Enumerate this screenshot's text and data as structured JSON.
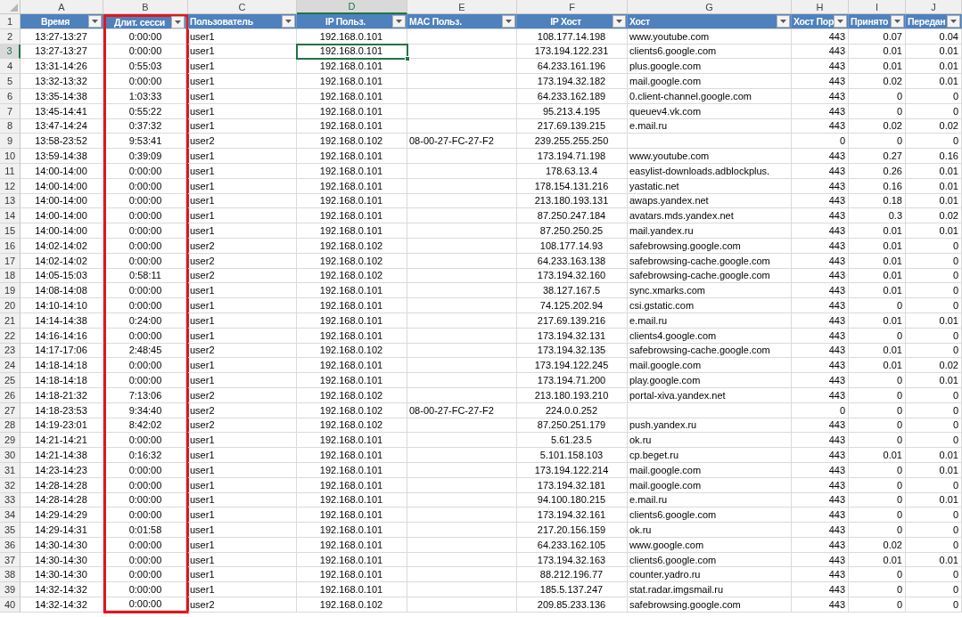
{
  "sheet": {
    "columns": [
      {
        "letter": "A",
        "title": "Время",
        "selected": false,
        "highlighted": false
      },
      {
        "letter": "B",
        "title": "Длит. сесси",
        "selected": false,
        "highlighted": true
      },
      {
        "letter": "C",
        "title": "Пользователь",
        "selected": false,
        "highlighted": false
      },
      {
        "letter": "D",
        "title": "IP Польз.",
        "selected": true,
        "highlighted": false
      },
      {
        "letter": "E",
        "title": "MAC Польз.",
        "selected": false,
        "highlighted": false
      },
      {
        "letter": "F",
        "title": "IP Хост",
        "selected": false,
        "highlighted": false
      },
      {
        "letter": "G",
        "title": "Хост",
        "selected": false,
        "highlighted": false
      },
      {
        "letter": "H",
        "title": "Хост Пор",
        "selected": false,
        "highlighted": false
      },
      {
        "letter": "I",
        "title": "Принято",
        "selected": false,
        "highlighted": false
      },
      {
        "letter": "J",
        "title": "Передан",
        "selected": false,
        "highlighted": false
      }
    ],
    "header_row": {
      "number": "1",
      "selected": false
    },
    "rows": [
      {
        "number": "2",
        "selected": false,
        "time": "13:27-13:27",
        "session_duration": "0:00:00",
        "user": "user1",
        "user_ip": "192.168.0.101",
        "host_ip": "108.177.14.198",
        "host": "www.youtube.com",
        "host_port": "443",
        "received": "0.07",
        "sent": "0.04"
      },
      {
        "number": "3",
        "selected": true,
        "time": "13:27-13:27",
        "session_duration": "0:00:00",
        "user": "user1",
        "user_ip": "192.168.0.101",
        "host_ip": "173.194.122.231",
        "host": "clients6.google.com",
        "host_port": "443",
        "received": "0.01",
        "sent": "0.01"
      },
      {
        "number": "4",
        "selected": false,
        "time": "13:31-14:26",
        "session_duration": "0:55:03",
        "user": "user1",
        "user_ip": "192.168.0.101",
        "host_ip": "64.233.161.196",
        "host": "plus.google.com",
        "host_port": "443",
        "received": "0.01",
        "sent": "0.01"
      },
      {
        "number": "5",
        "selected": false,
        "time": "13:32-13:32",
        "session_duration": "0:00:00",
        "user": "user1",
        "user_ip": "192.168.0.101",
        "host_ip": "173.194.32.182",
        "host": "mail.google.com",
        "host_port": "443",
        "received": "0.02",
        "sent": "0.01"
      },
      {
        "number": "6",
        "selected": false,
        "time": "13:35-14:38",
        "session_duration": "1:03:33",
        "user": "user1",
        "user_ip": "192.168.0.101",
        "host_ip": "64.233.162.189",
        "host": "0.client-channel.google.com",
        "host_port": "443",
        "received": "0",
        "sent": "0"
      },
      {
        "number": "7",
        "selected": false,
        "time": "13:45-14:41",
        "session_duration": "0:55:22",
        "user": "user1",
        "user_ip": "192.168.0.101",
        "host_ip": "95.213.4.195",
        "host": "queuev4.vk.com",
        "host_port": "443",
        "received": "0",
        "sent": "0"
      },
      {
        "number": "8",
        "selected": false,
        "time": "13:47-14:24",
        "session_duration": "0:37:32",
        "user": "user1",
        "user_ip": "192.168.0.101",
        "host_ip": "217.69.139.215",
        "host": "e.mail.ru",
        "host_port": "443",
        "received": "0.02",
        "sent": "0.02"
      },
      {
        "number": "9",
        "selected": false,
        "time": "13:58-23:52",
        "session_duration": "9:53:41",
        "user": "user2",
        "user_ip": "192.168.0.102",
        "user_mac": "08-00-27-FC-27-F2",
        "host_ip": "239.255.255.250",
        "host_port": "0",
        "received": "0",
        "sent": "0"
      },
      {
        "number": "10",
        "selected": false,
        "time": "13:59-14:38",
        "session_duration": "0:39:09",
        "user": "user1",
        "user_ip": "192.168.0.101",
        "host_ip": "173.194.71.198",
        "host": "www.youtube.com",
        "host_port": "443",
        "received": "0.27",
        "sent": "0.16"
      },
      {
        "number": "11",
        "selected": false,
        "time": "14:00-14:00",
        "session_duration": "0:00:00",
        "user": "user1",
        "user_ip": "192.168.0.101",
        "host_ip": "178.63.13.4",
        "host": "easylist-downloads.adblockplus.",
        "host_port": "443",
        "received": "0.26",
        "sent": "0.01"
      },
      {
        "number": "12",
        "selected": false,
        "time": "14:00-14:00",
        "session_duration": "0:00:00",
        "user": "user1",
        "user_ip": "192.168.0.101",
        "host_ip": "178.154.131.216",
        "host": "yastatic.net",
        "host_port": "443",
        "received": "0.16",
        "sent": "0.01"
      },
      {
        "number": "13",
        "selected": false,
        "time": "14:00-14:00",
        "session_duration": "0:00:00",
        "user": "user1",
        "user_ip": "192.168.0.101",
        "host_ip": "213.180.193.131",
        "host": "awaps.yandex.net",
        "host_port": "443",
        "received": "0.18",
        "sent": "0.01"
      },
      {
        "number": "14",
        "selected": false,
        "time": "14:00-14:00",
        "session_duration": "0:00:00",
        "user": "user1",
        "user_ip": "192.168.0.101",
        "host_ip": "87.250.247.184",
        "host": "avatars.mds.yandex.net",
        "host_port": "443",
        "received": "0.3",
        "sent": "0.02"
      },
      {
        "number": "15",
        "selected": false,
        "time": "14:00-14:00",
        "session_duration": "0:00:00",
        "user": "user1",
        "user_ip": "192.168.0.101",
        "host_ip": "87.250.250.25",
        "host": "mail.yandex.ru",
        "host_port": "443",
        "received": "0.01",
        "sent": "0.01"
      },
      {
        "number": "16",
        "selected": false,
        "time": "14:02-14:02",
        "session_duration": "0:00:00",
        "user": "user2",
        "user_ip": "192.168.0.102",
        "host_ip": "108.177.14.93",
        "host": "safebrowsing.google.com",
        "host_port": "443",
        "received": "0.01",
        "sent": "0"
      },
      {
        "number": "17",
        "selected": false,
        "time": "14:02-14:02",
        "session_duration": "0:00:00",
        "user": "user2",
        "user_ip": "192.168.0.102",
        "host_ip": "64.233.163.138",
        "host": "safebrowsing-cache.google.com",
        "host_port": "443",
        "received": "0.01",
        "sent": "0"
      },
      {
        "number": "18",
        "selected": false,
        "time": "14:05-15:03",
        "session_duration": "0:58:11",
        "user": "user2",
        "user_ip": "192.168.0.102",
        "host_ip": "173.194.32.160",
        "host": "safebrowsing-cache.google.com",
        "host_port": "443",
        "received": "0.01",
        "sent": "0"
      },
      {
        "number": "19",
        "selected": false,
        "time": "14:08-14:08",
        "session_duration": "0:00:00",
        "user": "user1",
        "user_ip": "192.168.0.101",
        "host_ip": "38.127.167.5",
        "host": "sync.xmarks.com",
        "host_port": "443",
        "received": "0.01",
        "sent": "0"
      },
      {
        "number": "20",
        "selected": false,
        "time": "14:10-14:10",
        "session_duration": "0:00:00",
        "user": "user1",
        "user_ip": "192.168.0.101",
        "host_ip": "74.125.202.94",
        "host": "csi.gstatic.com",
        "host_port": "443",
        "received": "0",
        "sent": "0"
      },
      {
        "number": "21",
        "selected": false,
        "time": "14:14-14:38",
        "session_duration": "0:24:00",
        "user": "user1",
        "user_ip": "192.168.0.101",
        "host_ip": "217.69.139.216",
        "host": "e.mail.ru",
        "host_port": "443",
        "received": "0.01",
        "sent": "0.01"
      },
      {
        "number": "22",
        "selected": false,
        "time": "14:16-14:16",
        "session_duration": "0:00:00",
        "user": "user1",
        "user_ip": "192.168.0.101",
        "host_ip": "173.194.32.131",
        "host": "clients4.google.com",
        "host_port": "443",
        "received": "0",
        "sent": "0"
      },
      {
        "number": "23",
        "selected": false,
        "time": "14:17-17:06",
        "session_duration": "2:48:45",
        "user": "user2",
        "user_ip": "192.168.0.102",
        "host_ip": "173.194.32.135",
        "host": "safebrowsing-cache.google.com",
        "host_port": "443",
        "received": "0.01",
        "sent": "0"
      },
      {
        "number": "24",
        "selected": false,
        "time": "14:18-14:18",
        "session_duration": "0:00:00",
        "user": "user1",
        "user_ip": "192.168.0.101",
        "host_ip": "173.194.122.245",
        "host": "mail.google.com",
        "host_port": "443",
        "received": "0.01",
        "sent": "0.02"
      },
      {
        "number": "25",
        "selected": false,
        "time": "14:18-14:18",
        "session_duration": "0:00:00",
        "user": "user1",
        "user_ip": "192.168.0.101",
        "host_ip": "173.194.71.200",
        "host": "play.google.com",
        "host_port": "443",
        "received": "0",
        "sent": "0.01"
      },
      {
        "number": "26",
        "selected": false,
        "time": "14:18-21:32",
        "session_duration": "7:13:06",
        "user": "user2",
        "user_ip": "192.168.0.102",
        "host_ip": "213.180.193.210",
        "host": "portal-xiva.yandex.net",
        "host_port": "443",
        "received": "0",
        "sent": "0"
      },
      {
        "number": "27",
        "selected": false,
        "time": "14:18-23:53",
        "session_duration": "9:34:40",
        "user": "user2",
        "user_ip": "192.168.0.102",
        "user_mac": "08-00-27-FC-27-F2",
        "host_ip": "224.0.0.252",
        "host_port": "0",
        "received": "0",
        "sent": "0"
      },
      {
        "number": "28",
        "selected": false,
        "time": "14:19-23:01",
        "session_duration": "8:42:02",
        "user": "user2",
        "user_ip": "192.168.0.102",
        "host_ip": "87.250.251.179",
        "host": "push.yandex.ru",
        "host_port": "443",
        "received": "0",
        "sent": "0"
      },
      {
        "number": "29",
        "selected": false,
        "time": "14:21-14:21",
        "session_duration": "0:00:00",
        "user": "user1",
        "user_ip": "192.168.0.101",
        "host_ip": "5.61.23.5",
        "host": "ok.ru",
        "host_port": "443",
        "received": "0",
        "sent": "0"
      },
      {
        "number": "30",
        "selected": false,
        "time": "14:21-14:38",
        "session_duration": "0:16:32",
        "user": "user1",
        "user_ip": "192.168.0.101",
        "host_ip": "5.101.158.103",
        "host": "cp.beget.ru",
        "host_port": "443",
        "received": "0.01",
        "sent": "0.01"
      },
      {
        "number": "31",
        "selected": false,
        "time": "14:23-14:23",
        "session_duration": "0:00:00",
        "user": "user1",
        "user_ip": "192.168.0.101",
        "host_ip": "173.194.122.214",
        "host": "mail.google.com",
        "host_port": "443",
        "received": "0",
        "sent": "0.01"
      },
      {
        "number": "32",
        "selected": false,
        "time": "14:28-14:28",
        "session_duration": "0:00:00",
        "user": "user1",
        "user_ip": "192.168.0.101",
        "host_ip": "173.194.32.181",
        "host": "mail.google.com",
        "host_port": "443",
        "received": "0",
        "sent": "0"
      },
      {
        "number": "33",
        "selected": false,
        "time": "14:28-14:28",
        "session_duration": "0:00:00",
        "user": "user1",
        "user_ip": "192.168.0.101",
        "host_ip": "94.100.180.215",
        "host": "e.mail.ru",
        "host_port": "443",
        "received": "0",
        "sent": "0.01"
      },
      {
        "number": "34",
        "selected": false,
        "time": "14:29-14:29",
        "session_duration": "0:00:00",
        "user": "user1",
        "user_ip": "192.168.0.101",
        "host_ip": "173.194.32.161",
        "host": "clients6.google.com",
        "host_port": "443",
        "received": "0",
        "sent": "0"
      },
      {
        "number": "35",
        "selected": false,
        "time": "14:29-14:31",
        "session_duration": "0:01:58",
        "user": "user1",
        "user_ip": "192.168.0.101",
        "host_ip": "217.20.156.159",
        "host": "ok.ru",
        "host_port": "443",
        "received": "0",
        "sent": "0"
      },
      {
        "number": "36",
        "selected": false,
        "time": "14:30-14:30",
        "session_duration": "0:00:00",
        "user": "user1",
        "user_ip": "192.168.0.101",
        "host_ip": "64.233.162.105",
        "host": "www.google.com",
        "host_port": "443",
        "received": "0.02",
        "sent": "0"
      },
      {
        "number": "37",
        "selected": false,
        "time": "14:30-14:30",
        "session_duration": "0:00:00",
        "user": "user1",
        "user_ip": "192.168.0.101",
        "host_ip": "173.194.32.163",
        "host": "clients6.google.com",
        "host_port": "443",
        "received": "0.01",
        "sent": "0.01"
      },
      {
        "number": "38",
        "selected": false,
        "time": "14:30-14:30",
        "session_duration": "0:00:00",
        "user": "user1",
        "user_ip": "192.168.0.101",
        "host_ip": "88.212.196.77",
        "host": "counter.yadro.ru",
        "host_port": "443",
        "received": "0",
        "sent": "0"
      },
      {
        "number": "39",
        "selected": false,
        "time": "14:32-14:32",
        "session_duration": "0:00:00",
        "user": "user1",
        "user_ip": "192.168.0.101",
        "host_ip": "185.5.137.247",
        "host": "stat.radar.imgsmail.ru",
        "host_port": "443",
        "received": "0",
        "sent": "0"
      },
      {
        "number": "40",
        "selected": false,
        "time": "14:32-14:32",
        "session_duration": "0:00:00",
        "user": "user2",
        "user_ip": "192.168.0.102",
        "host_ip": "209.85.233.136",
        "host": "safebrowsing.google.com",
        "host_port": "443",
        "received": "0",
        "sent": "0"
      }
    ]
  }
}
